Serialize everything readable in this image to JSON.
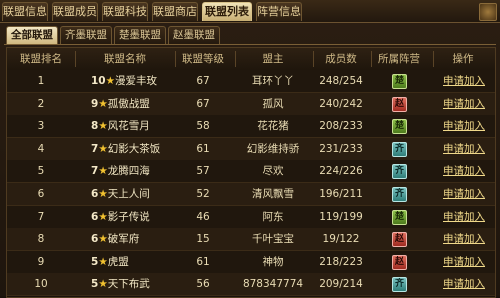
{
  "top_tabs": [
    "联盟信息",
    "联盟成员",
    "联盟科技",
    "联盟商店",
    "联盟列表",
    "阵营信息"
  ],
  "top_tab_active": 4,
  "sub_tabs": [
    "全部联盟",
    "齐墨联盟",
    "楚墨联盟",
    "赵墨联盟"
  ],
  "sub_tab_active": 0,
  "columns": [
    "联盟排名",
    "联盟名称",
    "联盟等级",
    "盟主",
    "成员数",
    "所属阵营",
    "操作"
  ],
  "camp_labels": {
    "green": "楚",
    "teal": "齐",
    "red": "赵"
  },
  "rows": [
    {
      "rank": "1",
      "level_stars": "10",
      "name": "漫爱丰玫",
      "alliance_level": "67",
      "leader": "耳环丫丫",
      "members": "248/254",
      "camp": "green",
      "action": "申请加入"
    },
    {
      "rank": "2",
      "level_stars": "9",
      "name": "孤傲战盟",
      "alliance_level": "67",
      "leader": "孤风",
      "members": "240/242",
      "camp": "red",
      "action": "申请加入"
    },
    {
      "rank": "3",
      "level_stars": "8",
      "name": "风花雪月",
      "alliance_level": "58",
      "leader": "花花猪",
      "members": "208/233",
      "camp": "green",
      "action": "申请加入"
    },
    {
      "rank": "4",
      "level_stars": "7",
      "name": "幻影大茶饭",
      "alliance_level": "61",
      "leader": "幻影维持骄",
      "members": "231/233",
      "camp": "teal",
      "action": "申请加入"
    },
    {
      "rank": "5",
      "level_stars": "7",
      "name": "龙腾四海",
      "alliance_level": "57",
      "leader": "尽欢",
      "members": "224/226",
      "camp": "teal",
      "action": "申请加入"
    },
    {
      "rank": "6",
      "level_stars": "6",
      "name": "天上人间",
      "alliance_level": "52",
      "leader": "清风飘雪",
      "members": "196/211",
      "camp": "teal",
      "action": "申请加入"
    },
    {
      "rank": "7",
      "level_stars": "6",
      "name": "影子传说",
      "alliance_level": "46",
      "leader": "阿东",
      "members": "119/199",
      "camp": "green",
      "action": "申请加入"
    },
    {
      "rank": "8",
      "level_stars": "6",
      "name": "破军府",
      "alliance_level": "15",
      "leader": "千叶宝宝",
      "members": "19/122",
      "camp": "red",
      "action": "申请加入"
    },
    {
      "rank": "9",
      "level_stars": "5",
      "name": "虎盟",
      "alliance_level": "61",
      "leader": "神物",
      "members": "218/223",
      "camp": "red",
      "action": "申请加入"
    },
    {
      "rank": "10",
      "level_stars": "5",
      "name": "天下布武",
      "alliance_level": "56",
      "leader": "878347774",
      "members": "209/214",
      "camp": "teal",
      "action": "申请加入"
    }
  ]
}
